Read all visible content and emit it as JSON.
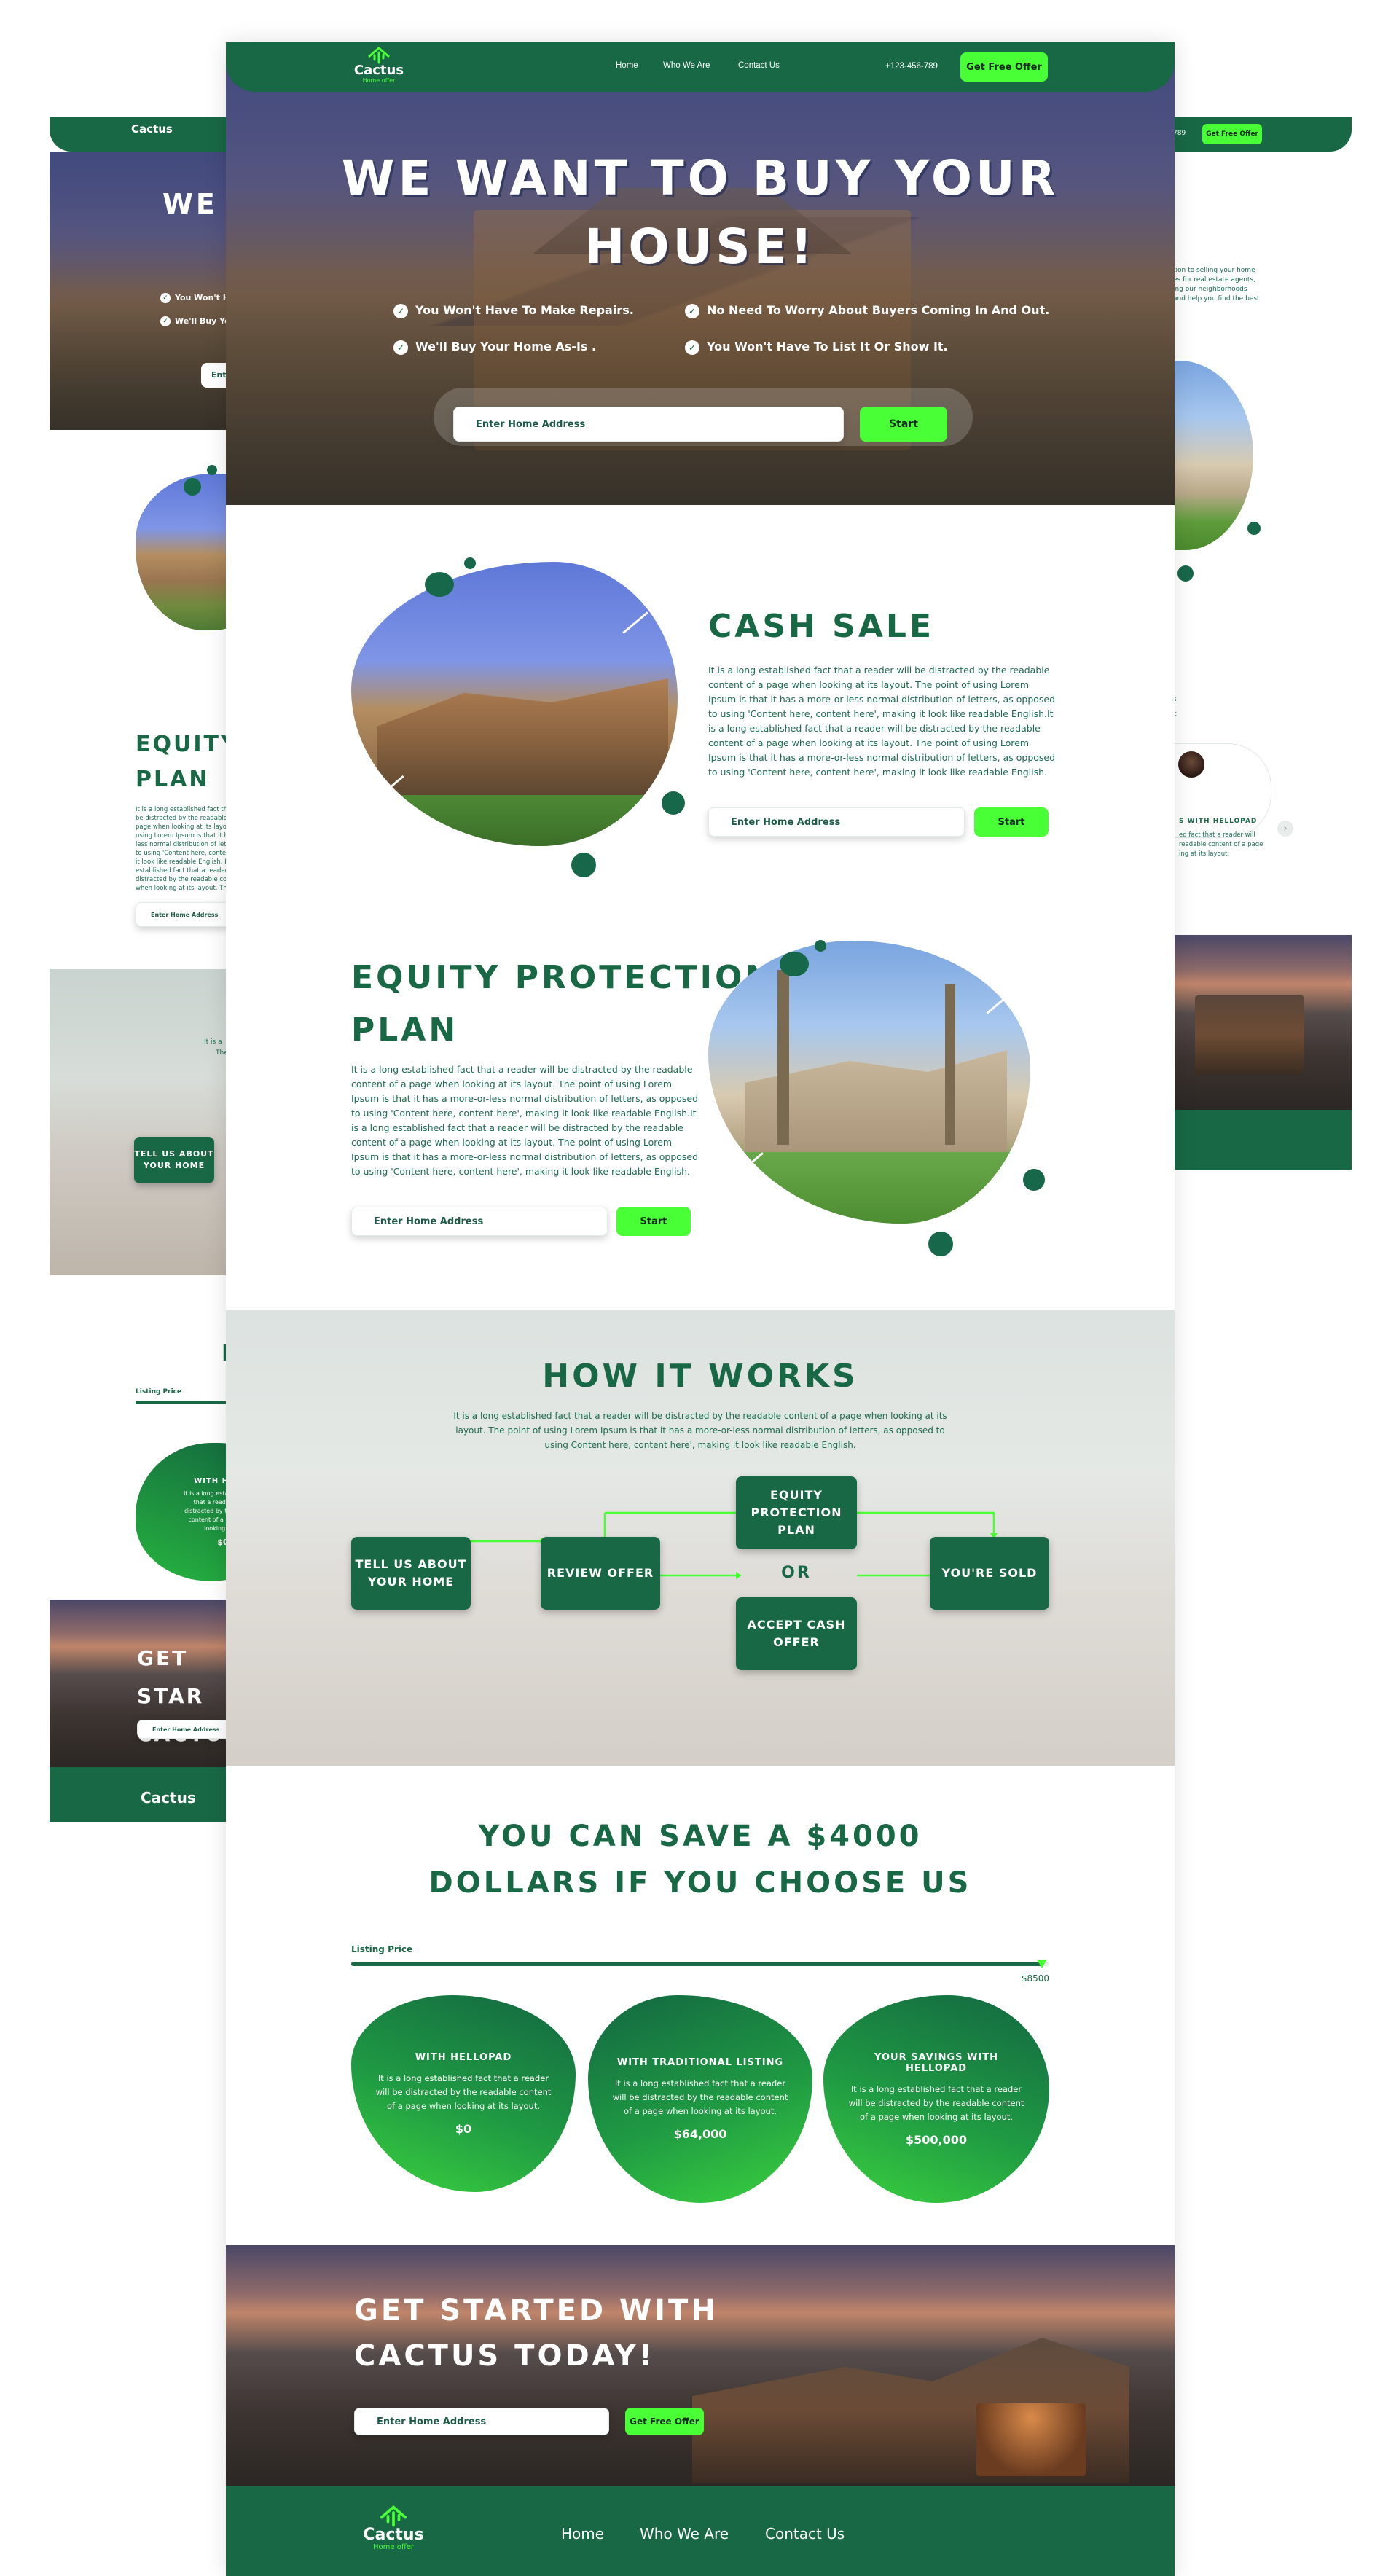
{
  "brand": {
    "name": "Cactus",
    "tagline": "Home offer",
    "accent": "#49ff35",
    "primary": "#186846"
  },
  "nav": {
    "items": [
      "Home",
      "Who We Are",
      "Contact Us"
    ],
    "phone": "+123-456-789",
    "cta": "Get Free Offer"
  },
  "hero": {
    "title_line1": "WE WANT TO BUY YOUR",
    "title_line2": "HOUSE!",
    "benefits": [
      "You Won't Have To Make Repairs.",
      "No Need To Worry About Buyers Coming In And Out.",
      "We'll Buy Your Home As-Is .",
      "You Won't Have To List It Or Show It."
    ],
    "input_placeholder": "Enter Home Address",
    "button": "Start"
  },
  "cash_sale": {
    "title": "CASH SALE",
    "body": "It is a long established fact that a reader will be distracted by the readable content of a page when looking at its layout. The point of using Lorem Ipsum is that it has a more-or-less normal distribution of letters, as opposed to using 'Content here, content here', making it look like readable English.It is a long established fact that a reader will be distracted by the readable content of a page when looking at its layout. The point of using Lorem Ipsum is that it has a more-or-less normal distribution of letters, as opposed to using 'Content here, content here', making it look like readable English.",
    "input_placeholder": "Enter Home Address",
    "button": "Start"
  },
  "equity": {
    "title_line1": "EQUITY PROTECTION",
    "title_line2": "PLAN",
    "body": "It is a long established fact that a reader will be distracted by the readable content of a page when looking at its layout. The point of using Lorem Ipsum is that it has a more-or-less normal distribution of letters, as opposed to using 'Content here, content here', making it look like readable English.It is a long established fact that a reader will be distracted by the readable content of a page when looking at its layout. The point of using Lorem Ipsum is that it has a more-or-less normal distribution of letters, as opposed to using 'Content here, content here', making it look like readable English.",
    "input_placeholder": "Enter Home Address",
    "button": "Start"
  },
  "how": {
    "title": "HOW IT WORKS",
    "intro": "It is a long established fact that a reader will be distracted by the readable content of a page when looking at its layout. The point of using Lorem Ipsum is that it has a more-or-less normal distribution of letters, as opposed to using Content here, content here', making it look like readable English.",
    "steps": {
      "tell": "TELL US ABOUT YOUR HOME",
      "review": "REVIEW OFFER",
      "equity": "EQUITY PROTECTION PLAN",
      "or": "OR",
      "cash": "ACCEPT CASH OFFER",
      "sold": "YOU'RE SOLD"
    }
  },
  "savings": {
    "title_line1": "YOU CAN SAVE A $4000",
    "title_line2": "DOLLARS IF YOU CHOOSE US",
    "slider_label": "Listing Price",
    "slider_value": "$8500",
    "slider_fraction": 0.99,
    "cards": [
      {
        "title": "WITH HELLOPAD",
        "body": "It is a long established fact that a reader will be distracted by the readable content of a page when looking at its layout.",
        "value": "$0"
      },
      {
        "title": "WITH TRADITIONAL LISTING",
        "body": "It is a long established fact that a reader will be distracted by the readable content of a page when looking at its layout.",
        "value": "$64,000"
      },
      {
        "title": "YOUR SAVINGS WITH HELLOPAD",
        "body": "It is a long established fact that a reader will be distracted by the readable content of a page when looking at its layout.",
        "value": "$500,000"
      }
    ]
  },
  "cta": {
    "title_line1": "GET STARTED WITH",
    "title_line2": "CACTUS TODAY!",
    "input_placeholder": "Enter Home Address",
    "button": "Get Free Offer"
  },
  "footer": {
    "items": [
      "Home",
      "Who We Are",
      "Contact Us"
    ]
  },
  "left_preview": {
    "benefits": [
      "You Won't H",
      "We'll Buy Yo"
    ],
    "input_fragment": "Ent",
    "equity_title_line1": "EQUITY",
    "equity_title_line2": "PLAN",
    "body": "It is a long established fact that a reader will be distracted by the readable content of a page when looking at its layout. The point of using Lorem Ipsum is that it has a more-or-less normal distribution of letters, as opposed to using 'Content here, content here', making it look like readable English. It is a long established fact that a reader will be distracted by the readable content of a page when looking at its layout. The point of using Lorem Ipsum is that it has a more-or-less normal distribution of letters, as opposed to using 'Content here, content here', making it look like readable English.",
    "input_placeholder": "Enter Home Address",
    "faded_text": "It is a",
    "faded_text2": "The",
    "step": "TELL US ABOUT YOUR HOME",
    "fragment_letter": "D",
    "slider_label": "Listing Price",
    "card_title": "WITH HELLO",
    "card_body": "It is a long established fact that a reader will be distracted by the readable content of a page when looking at its",
    "card_value": "$0",
    "cta_line1": "GET STAR",
    "cta_line2": "CACTUS",
    "cta_input": "Enter Home Address"
  },
  "right_preview": {
    "nav_fragment": "789",
    "cta": "Get Free Offer",
    "text_lines": [
      "tion to selling your home",
      "es for real estate agents,",
      "ing our neighborhoods",
      "and help you find the best"
    ],
    "small_letters": [
      "s",
      "c"
    ],
    "review_title": "S WITH HELLOPAD",
    "review_lines": [
      "ed fact that a reader will",
      "readable content of a page",
      "ing at its layout."
    ],
    "arrow": "›"
  }
}
